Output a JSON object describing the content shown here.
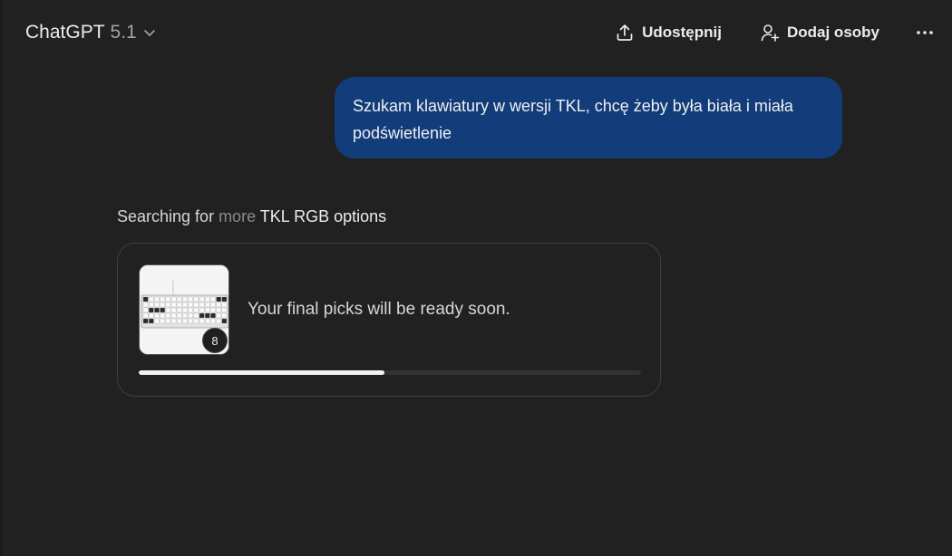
{
  "header": {
    "model_name": "ChatGPT",
    "model_version": "5.1",
    "share_label": "Udostępnij",
    "add_people_label": "Dodaj osoby"
  },
  "conversation": {
    "user_message": "Szukam klawiatury w wersji TKL, chcę żeby była biała i miała podświetlenie"
  },
  "status": {
    "part1": "Searching for",
    "part2": " more",
    "part3": " TKL RGB options"
  },
  "card": {
    "message": "Your final picks will be ready soon.",
    "image_count": "8",
    "progress_fraction": 0.49
  },
  "icons": {
    "model_chevron": "chevron-down-icon",
    "share": "upload-icon",
    "add_people": "add-person-icon",
    "more": "more-horizontal-icon"
  }
}
